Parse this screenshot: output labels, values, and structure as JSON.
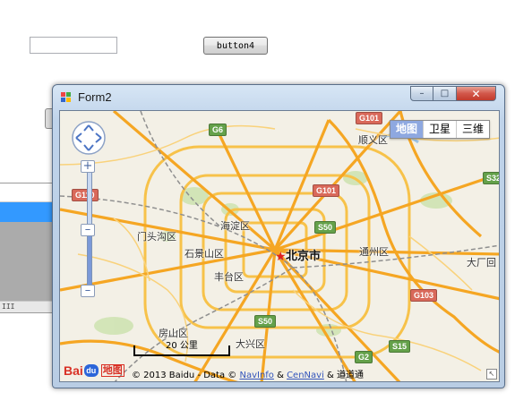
{
  "background": {
    "textbox_value": "",
    "button_label": "button4",
    "scrollbar_glyph": "III"
  },
  "window": {
    "title": "Form2",
    "minimize_glyph": "–",
    "maximize_glyph": "□",
    "close_glyph": "✕"
  },
  "map": {
    "type_buttons": [
      "地图",
      "卫星",
      "三维"
    ],
    "zoom_in": "+",
    "zoom_handle": "–",
    "zoom_out": "–",
    "capital": "北京市",
    "districts": {
      "shunyi": "顺义区",
      "mentougou": "门头沟区",
      "haidian": "海淀区",
      "shijingshan": "石景山区",
      "fengtai": "丰台区",
      "tongzhou": "通州区",
      "fangshan": "房山区",
      "daxing": "大兴区",
      "dachang": "大厂回"
    },
    "road_shields": {
      "g101_top": "G101",
      "g6": "G6",
      "s32": "S32",
      "g110": "G110",
      "g101_mid": "G101",
      "s50_top": "S50",
      "g103": "G103",
      "s50_bottom": "S50",
      "s15": "S15",
      "g2": "G2"
    },
    "scale_label": "20 公里",
    "logo": {
      "bai": "Bai",
      "du": "du",
      "maptext": "地图"
    },
    "copyright": {
      "prefix": "© 2013 Baidu - Data © ",
      "navinfo": "NavInfo",
      "amp": " & ",
      "cennavi": "CenNavi",
      "tail": " & 道道通"
    },
    "corner_glyph": "↖"
  },
  "colors": {
    "map_bg": "#f3f0e6",
    "road_major": "#f5a623",
    "road_ring": "#f7c24a",
    "park": "#cfe3b3",
    "maptype_active": "#8ea8e0",
    "selection_blue": "#3399ff"
  }
}
